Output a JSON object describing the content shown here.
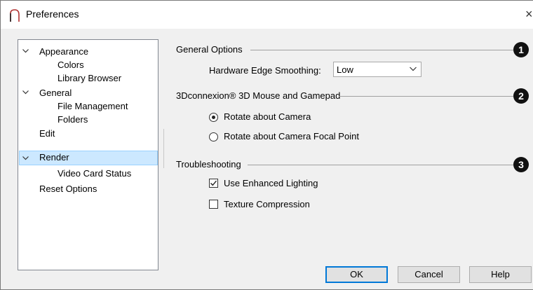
{
  "window": {
    "title": "Preferences",
    "close_glyph": "×"
  },
  "tree": {
    "items": [
      {
        "label": "Appearance",
        "expanded": true
      },
      {
        "label": "Colors"
      },
      {
        "label": "Library Browser"
      },
      {
        "label": "General",
        "expanded": true
      },
      {
        "label": "File Management"
      },
      {
        "label": "Folders"
      },
      {
        "label": "Edit"
      },
      {
        "label": "Render",
        "expanded": true,
        "selected": true
      },
      {
        "label": "Video Card Status"
      },
      {
        "label": "Reset Options"
      }
    ]
  },
  "general_options": {
    "title": "General Options",
    "callout": "1",
    "edge_smoothing_label": "Hardware Edge Smoothing:",
    "edge_smoothing_value": "Low"
  },
  "mouse_section": {
    "title": "3Dconnexion® 3D Mouse and Gamepad",
    "callout": "2",
    "options": [
      {
        "label": "Rotate about Camera",
        "checked": true
      },
      {
        "label": "Rotate about Camera Focal Point",
        "checked": false
      }
    ]
  },
  "troubleshooting": {
    "title": "Troubleshooting",
    "callout": "3",
    "options": [
      {
        "label": "Use Enhanced Lighting",
        "checked": true
      },
      {
        "label": "Texture Compression",
        "checked": false
      }
    ]
  },
  "buttons": {
    "ok": "OK",
    "cancel": "Cancel",
    "help": "Help"
  },
  "colors": {
    "selection_bg": "#cce8ff",
    "selection_border": "#99d1ff",
    "default_button_border": "#0078d7"
  }
}
